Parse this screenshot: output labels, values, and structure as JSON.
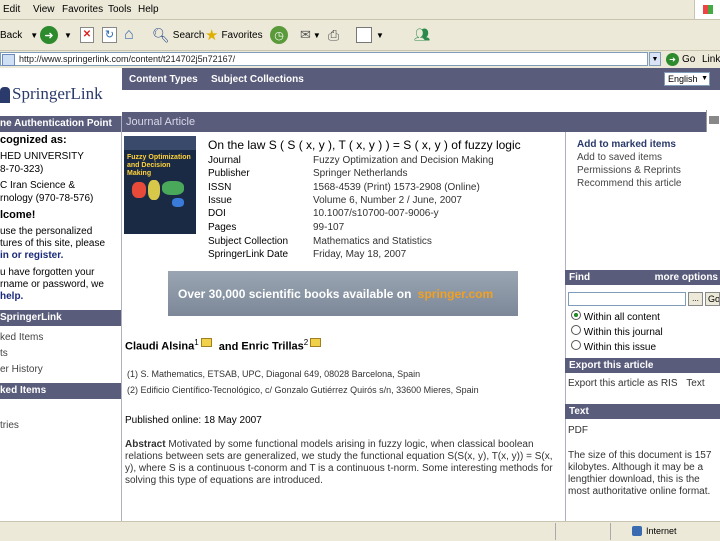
{
  "browser": {
    "menu": [
      "Edit",
      "View",
      "Favorites",
      "Tools",
      "Help"
    ],
    "toolbar": {
      "back": "Back",
      "search": "Search",
      "favorites": "Favorites"
    },
    "address": "http://www.springerlink.com/content/t214702j5n72167/",
    "go": "Go",
    "links": "Links",
    "status_zone": "Internet"
  },
  "site": {
    "logo": "SpringerLink",
    "nav": {
      "content_types": "Content Types",
      "subject_collections": "Subject Collections"
    },
    "language": "English",
    "page_type": "Journal Article"
  },
  "left": {
    "auth_point": "ne Authentication Point",
    "recognized_as": "cognized as:",
    "lines": [
      "HED UNIVERSITY",
      "8-70-323)",
      "C Iran Science &",
      "rnology (970-78-576)"
    ],
    "welcome": "lcome!",
    "personalized": [
      "use the personalized",
      "tures of this site, please",
      "in or register."
    ],
    "forgot": [
      "u have forgotten your",
      "rname or password, we",
      "help."
    ],
    "section_springerlink": "SpringerLink",
    "items": [
      "ked Items",
      "ts",
      "er History"
    ],
    "section_marked": "ked Items",
    "bottom_item": "tries"
  },
  "article": {
    "title": "On the law S ( S ( x, y ), T ( x, y ) ) = S ( x, y ) of fuzzy logic",
    "cover_title": "Fuzzy Optimization and Decision Making",
    "meta": [
      {
        "label": "Journal",
        "value": "Fuzzy Optimization and Decision Making"
      },
      {
        "label": "Publisher",
        "value": "Springer Netherlands"
      },
      {
        "label": "ISSN",
        "value": "1568-4539 (Print) 1573-2908 (Online)"
      },
      {
        "label": "Issue",
        "value": "Volume 6, Number 2 / June, 2007"
      },
      {
        "label": "DOI",
        "value": "10.1007/s10700-007-9006-y"
      },
      {
        "label": "Pages",
        "value": "99-107"
      },
      {
        "label": "Subject Collection",
        "value": "Mathematics and Statistics"
      },
      {
        "label": "SpringerLink Date",
        "value": "Friday, May 18, 2007"
      }
    ],
    "banner_text": "Over 30,000 scientific books available on",
    "banner_brand": "springer.com",
    "author1": "Claudi Alsina",
    "author1_sup": "1",
    "and": "and",
    "author2": "Enric Trillas",
    "author2_sup": "2",
    "affil1": "(1)  S. Mathematics, ETSAB, UPC, Diagonal 649, 08028 Barcelona, Spain",
    "affil2": "(2)  Edificio Científico-Tecnológico, c/ Gonzalo Gutiérrez Quirós s/n, 33600 Mieres, Spain",
    "published": "Published online: 18 May 2007",
    "abstract_label": "Abstract",
    "abstract": "Motivated by some functional models arising in fuzzy logic, when classical boolean relations between sets are generalized, we study the functional equation S(S(x, y), T(x, y)) = S(x, y), where S is a continuous t-conorm and T is a continuous t-norm. Some interesting methods for solving this type of equations are introduced."
  },
  "right": {
    "actions": [
      "Add to marked items",
      "Add to saved items",
      "Permissions & Reprints",
      "Recommend this article"
    ],
    "find_label": "Find",
    "more_options": "more options",
    "find_go": "Go",
    "scopes": [
      "Within all content",
      "Within this journal",
      "Within this issue"
    ],
    "export_label": "Export this article",
    "export_text": "Export this article as RIS",
    "export_text_link": "Text",
    "text_label": "Text",
    "pdf": "PDF",
    "pdf_desc": "The size of this document is 157 kilobytes. Although it may be a lengthier download, this is the most authoritative online format."
  }
}
